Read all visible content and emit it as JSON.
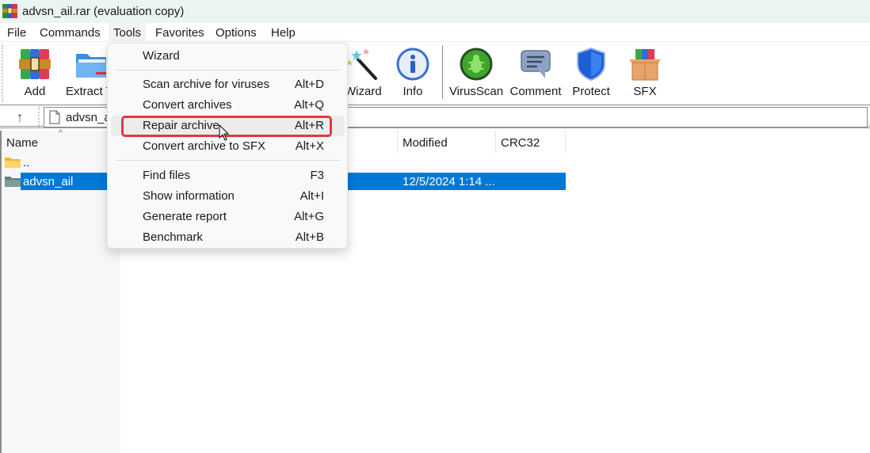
{
  "window": {
    "title": "advsn_ail.rar (evaluation copy)",
    "app_icon": "winrar-books-icon"
  },
  "menubar": {
    "items": [
      {
        "label": "File"
      },
      {
        "label": "Commands"
      },
      {
        "label": "Tools",
        "active": true
      },
      {
        "label": "Favorites"
      },
      {
        "label": "Options"
      },
      {
        "label": "Help"
      }
    ]
  },
  "toolbar": {
    "buttons": [
      {
        "label": "Add",
        "icon": "books-strap-icon"
      },
      {
        "label": "Extract To",
        "icon": "blue-folder-icon"
      },
      {
        "label": "Wizard",
        "icon": "magic-wand-icon"
      },
      {
        "label": "Info",
        "icon": "info-icon"
      },
      {
        "label": "VirusScan",
        "icon": "bug-scan-icon"
      },
      {
        "label": "Comment",
        "icon": "comment-bubble-icon"
      },
      {
        "label": "Protect",
        "icon": "shield-icon"
      },
      {
        "label": "SFX",
        "icon": "sfx-box-icon"
      }
    ],
    "extract_label_visible": "Extract T"
  },
  "addressbar": {
    "up_icon": "up-arrow-icon",
    "path": "advsn_ail.rar",
    "path_visible": "advsn_a"
  },
  "filelist": {
    "columns": [
      {
        "label": "Name",
        "sorted": "ascending"
      },
      {
        "label": "Modified"
      },
      {
        "label": "CRC32"
      }
    ],
    "rows": [
      {
        "name": "..",
        "type": "parent-folder",
        "modified": ""
      },
      {
        "name": "advsn_ail",
        "type": "folder",
        "modified": "12/5/2024 1:14 ...",
        "selected": true
      }
    ]
  },
  "tools_menu": {
    "items": [
      {
        "label": "Wizard",
        "shortcut": ""
      },
      {
        "separator": true
      },
      {
        "label": "Scan archive for viruses",
        "shortcut": "Alt+D"
      },
      {
        "label": "Convert archives",
        "shortcut": "Alt+Q"
      },
      {
        "label": "Repair archive",
        "shortcut": "Alt+R",
        "hovered": true,
        "highlighted": true
      },
      {
        "label": "Convert archive to SFX",
        "shortcut": "Alt+X"
      },
      {
        "separator": true
      },
      {
        "label": "Find files",
        "shortcut": "F3"
      },
      {
        "label": "Show information",
        "shortcut": "Alt+I"
      },
      {
        "label": "Generate report",
        "shortcut": "Alt+G"
      },
      {
        "label": "Benchmark",
        "shortcut": "Alt+B"
      }
    ]
  },
  "colors": {
    "selection": "#0078d7",
    "highlight_border": "#e0393e",
    "titlebar_bg": "#eaf5f1"
  }
}
